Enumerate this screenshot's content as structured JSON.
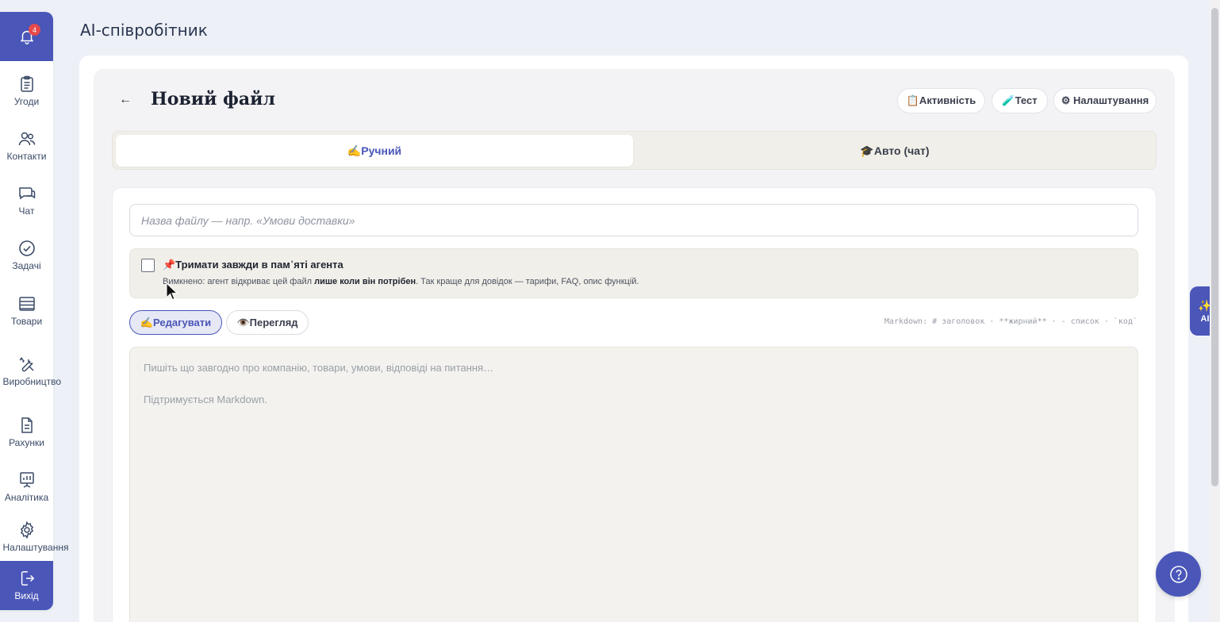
{
  "app": {
    "page_title": "AI-співробітник"
  },
  "notifications": {
    "count": "4"
  },
  "sidebar": {
    "items": [
      {
        "label": "Угоди",
        "icon": "clipboard-icon"
      },
      {
        "label": "Контакти",
        "icon": "users-icon"
      },
      {
        "label": "Чат",
        "icon": "chat-icon"
      },
      {
        "label": "Задачі",
        "icon": "check-circle-icon"
      },
      {
        "label": "Товари",
        "icon": "table-icon"
      },
      {
        "label": "Виробництво",
        "icon": "tools-icon"
      },
      {
        "label": "Рахунки",
        "icon": "document-icon"
      },
      {
        "label": "Аналітика",
        "icon": "chart-board-icon"
      },
      {
        "label": "Налаштування",
        "icon": "gear-icon"
      }
    ],
    "exit_label": "Вихід"
  },
  "header": {
    "back": "←",
    "title": "Новий файл",
    "buttons": {
      "activity": "📋Активність",
      "test": "🧪Тест",
      "settings": "⚙ Налаштування"
    }
  },
  "tabs": {
    "manual": "✍️Ручний",
    "auto": "🎓Авто (чат)"
  },
  "form": {
    "name_placeholder": "Назва файлу — напр. «Умови доставки»",
    "memory_title": "📌Тримати завжди в пам᾽яті агента",
    "memory_desc_start": "Вимкнено: агент відкриває цей файл ",
    "memory_desc_bold": "лише коли він потрібен",
    "memory_desc_end": ". Так краще для довідок — тарифи, FAQ, опис функцій.",
    "edit_label": "✍️Редагувати",
    "view_label": "👁️Перегляд",
    "markdown_hint": "Markdown: # заголовок · **жирний** · - список · `код`",
    "editor_placeholder_line1": "Пишіть що завгодно про компанію, товари, умови, відповіді на питання…",
    "editor_placeholder_line2": "Підтримується Markdown."
  },
  "ai_button": {
    "label": "AI",
    "icon": "sparkles-icon"
  },
  "colors": {
    "accent": "#4a56b8",
    "badge": "#e64a4a",
    "background": "#edf1f7"
  }
}
